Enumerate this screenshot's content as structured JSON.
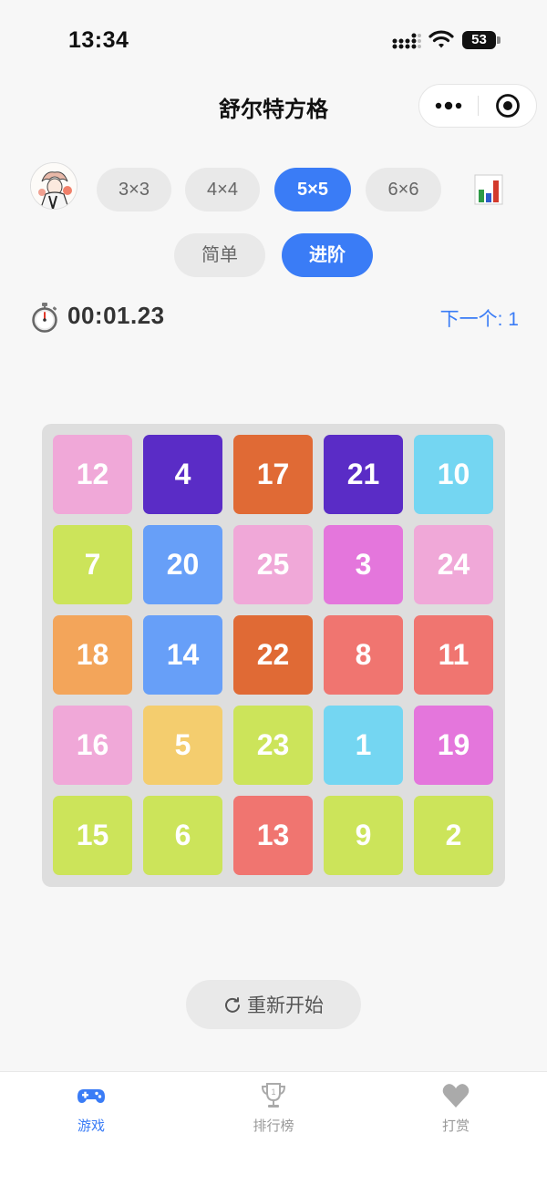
{
  "status_bar": {
    "time": "13:34",
    "battery": "53"
  },
  "nav": {
    "title": "舒尔特方格"
  },
  "sizes": [
    {
      "label": "3×3",
      "active": false
    },
    {
      "label": "4×4",
      "active": false
    },
    {
      "label": "5×5",
      "active": true
    },
    {
      "label": "6×6",
      "active": false
    }
  ],
  "difficulty": [
    {
      "label": "简单",
      "active": false
    },
    {
      "label": "进阶",
      "active": true
    }
  ],
  "timer": {
    "value": "00:01.23"
  },
  "next": {
    "label": "下一个: 1"
  },
  "board": {
    "grid_size": 5,
    "tiles": [
      {
        "number": "12",
        "color": "#f0a8d8"
      },
      {
        "number": "4",
        "color": "#5a2cc6"
      },
      {
        "number": "17",
        "color": "#e06a35"
      },
      {
        "number": "21",
        "color": "#5a2cc6"
      },
      {
        "number": "10",
        "color": "#74d6f2"
      },
      {
        "number": "7",
        "color": "#cce45a"
      },
      {
        "number": "20",
        "color": "#679ff8"
      },
      {
        "number": "25",
        "color": "#f0a8d8"
      },
      {
        "number": "3",
        "color": "#e476dc"
      },
      {
        "number": "24",
        "color": "#f0a8d8"
      },
      {
        "number": "18",
        "color": "#f3a55a"
      },
      {
        "number": "14",
        "color": "#679ff8"
      },
      {
        "number": "22",
        "color": "#e06a35"
      },
      {
        "number": "8",
        "color": "#f07570"
      },
      {
        "number": "11",
        "color": "#f07570"
      },
      {
        "number": "16",
        "color": "#f0a8d8"
      },
      {
        "number": "5",
        "color": "#f4cd6e"
      },
      {
        "number": "23",
        "color": "#cce45a"
      },
      {
        "number": "1",
        "color": "#74d6f2"
      },
      {
        "number": "19",
        "color": "#e476dc"
      },
      {
        "number": "15",
        "color": "#cce45a"
      },
      {
        "number": "6",
        "color": "#cce45a"
      },
      {
        "number": "13",
        "color": "#f07570"
      },
      {
        "number": "9",
        "color": "#cce45a"
      },
      {
        "number": "2",
        "color": "#cce45a"
      }
    ]
  },
  "restart": {
    "label": "重新开始"
  },
  "tabs": [
    {
      "label": "游戏",
      "icon": "gamepad-icon",
      "active": true
    },
    {
      "label": "排行榜",
      "icon": "trophy-icon",
      "active": false
    },
    {
      "label": "打赏",
      "icon": "heart-icon",
      "active": false
    }
  ],
  "colors": {
    "accent": "#3a7cf6",
    "inactive_pill": "#e9e9e9",
    "board_bg": "#dedede"
  }
}
